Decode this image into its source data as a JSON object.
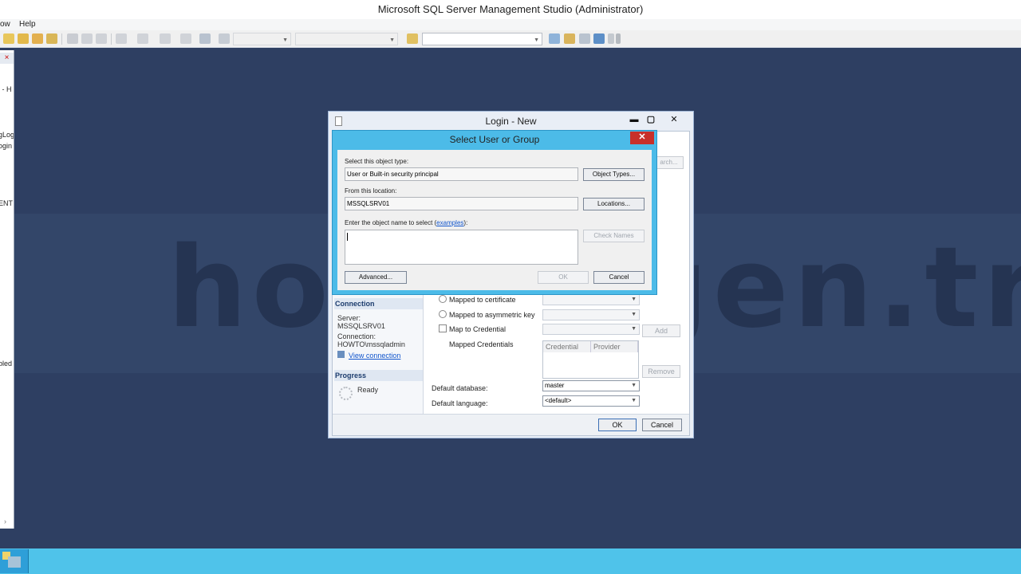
{
  "window": {
    "title": "Microsoft SQL Server Management Studio (Administrator)"
  },
  "menu": {
    "items": [
      "ow",
      "Help"
    ]
  },
  "left_panel": {
    "fragments": [
      "l - H",
      "gLog",
      "ogin",
      "ENT",
      "bled"
    ],
    "close_glyph": "×",
    "scroll_glyph": "›"
  },
  "watermark": "howto.gen.tr",
  "login_dialog": {
    "title": "Login - New",
    "controls": {
      "minimize": "▬",
      "maximize": "▢",
      "close": "✕"
    },
    "search_fragment": "arch...",
    "sidebar": {
      "connection_header": "Connection",
      "server_label": "Server:",
      "server_value": "MSSQLSRV01",
      "connection_label": "Connection:",
      "connection_value": "HOWTO\\mssqladmin",
      "view_connection": "View connection",
      "progress_header": "Progress",
      "progress_status": "Ready"
    },
    "options": {
      "mapped_certificate": "Mapped to certificate",
      "mapped_asymmetric_key": "Mapped to asymmetric key",
      "map_to_credential": "Map to Credential",
      "mapped_credentials": "Mapped Credentials",
      "add_button": "Add",
      "remove_button": "Remove",
      "grid_headers": [
        "Credential",
        "Provider"
      ]
    },
    "default_database_label": "Default database:",
    "default_database_value": "master",
    "default_language_label": "Default language:",
    "default_language_value": "<default>",
    "ok_button": "OK",
    "cancel_button": "Cancel"
  },
  "select_dialog": {
    "title": "Select User or Group",
    "close": "✕",
    "object_type_label": "Select this object type:",
    "object_type_value": "User or Built-in security principal",
    "object_types_button": "Object Types...",
    "location_label": "From this location:",
    "location_value": "MSSQLSRV01",
    "locations_button": "Locations...",
    "object_name_label_prefix": "Enter the object name to select (",
    "object_name_label_link": "examples",
    "object_name_label_suffix": "):",
    "object_name_value": "",
    "check_names_button": "Check Names",
    "advanced_button": "Advanced...",
    "ok_button": "OK",
    "cancel_button": "Cancel"
  }
}
